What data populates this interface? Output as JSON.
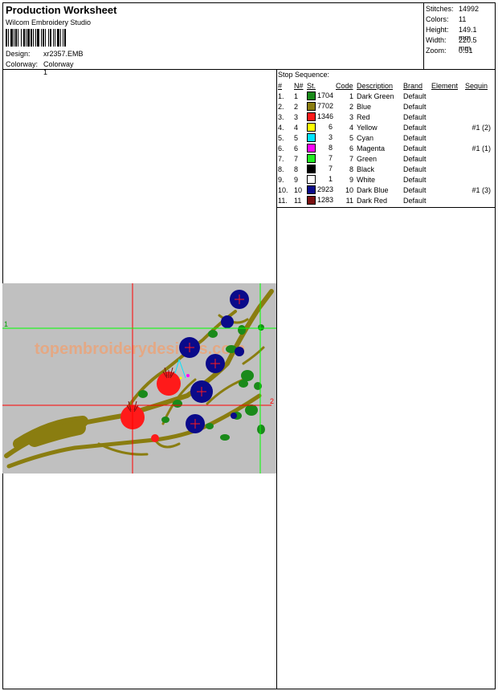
{
  "header": {
    "title": "Production Worksheet",
    "app_name": "Wilcom Embroidery Studio",
    "design_label": "Design:",
    "design_value": "xr2357.EMB",
    "colorway_label": "Colorway:",
    "colorway_value": "Colorway 1"
  },
  "stats": [
    {
      "label": "Stitches:",
      "value": "14992"
    },
    {
      "label": "Colors:",
      "value": "11"
    },
    {
      "label": "Height:",
      "value": "149.1 mm"
    },
    {
      "label": "Width:",
      "value": "220.5 mm"
    },
    {
      "label": "Zoom:",
      "value": "0.51"
    }
  ],
  "stop_sequence": {
    "title": "Stop Sequence:",
    "columns": [
      "#",
      "N#",
      "St.",
      "Code",
      "Description",
      "Brand",
      "Element",
      "Sequin"
    ],
    "rows": [
      {
        "num": "1.",
        "n": "1",
        "color": "#1a8a1a",
        "st": "1704",
        "code": "1",
        "desc": "Dark Green",
        "brand": "Default",
        "element": "",
        "sequin": ""
      },
      {
        "num": "2.",
        "n": "2",
        "color": "#8a7d10",
        "st": "7702",
        "code": "2",
        "desc": "Blue",
        "brand": "Default",
        "element": "",
        "sequin": ""
      },
      {
        "num": "3.",
        "n": "3",
        "color": "#ff1a1a",
        "st": "1346",
        "code": "3",
        "desc": "Red",
        "brand": "Default",
        "element": "",
        "sequin": ""
      },
      {
        "num": "4.",
        "n": "4",
        "color": "#ffff00",
        "st": "6",
        "code": "4",
        "desc": "Yellow",
        "brand": "Default",
        "element": "",
        "sequin": "#1 (2)"
      },
      {
        "num": "5.",
        "n": "5",
        "color": "#00e5ff",
        "st": "3",
        "code": "5",
        "desc": "Cyan",
        "brand": "Default",
        "element": "",
        "sequin": ""
      },
      {
        "num": "6.",
        "n": "6",
        "color": "#ff00ff",
        "st": "8",
        "code": "6",
        "desc": "Magenta",
        "brand": "Default",
        "element": "",
        "sequin": "#1 (1)"
      },
      {
        "num": "7.",
        "n": "7",
        "color": "#22ee22",
        "st": "7",
        "code": "7",
        "desc": "Green",
        "brand": "Default",
        "element": "",
        "sequin": ""
      },
      {
        "num": "8.",
        "n": "8",
        "color": "#000000",
        "st": "7",
        "code": "8",
        "desc": "Black",
        "brand": "Default",
        "element": "",
        "sequin": ""
      },
      {
        "num": "9.",
        "n": "9",
        "color": "#ffffff",
        "st": "1",
        "code": "9",
        "desc": "White",
        "brand": "Default",
        "element": "",
        "sequin": ""
      },
      {
        "num": "10.",
        "n": "10",
        "color": "#0a0a8a",
        "st": "2923",
        "code": "10",
        "desc": "Dark Blue",
        "brand": "Default",
        "element": "",
        "sequin": "#1 (3)"
      },
      {
        "num": "11.",
        "n": "11",
        "color": "#7a1010",
        "st": "1283",
        "code": "11",
        "desc": "Dark Red",
        "brand": "Default",
        "element": "",
        "sequin": ""
      }
    ]
  },
  "preview": {
    "watermark": "topembroiderydesigns.com",
    "guide1": "1",
    "guide2": "2"
  },
  "colors": {
    "background": "#c0c0c0",
    "guide_red": "#ff0000",
    "guide_green": "#00ff00",
    "branch": "#8a7d10",
    "leaf": "#1a8a1a",
    "flower_red": "#ff1a1a",
    "flower_blue": "#0a0a8a"
  }
}
